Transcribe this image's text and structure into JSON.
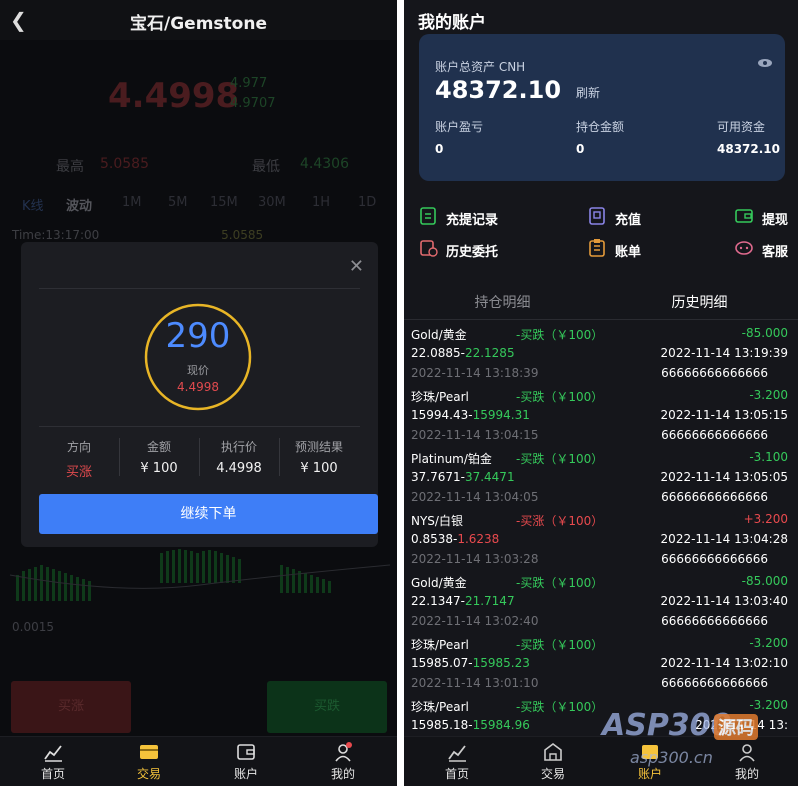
{
  "left": {
    "header": {
      "back_icon": "chevron-left-icon",
      "title": "宝石/Gemstone"
    },
    "ticker": {
      "price": "4.4998",
      "sub1": "4.977",
      "sub2": "4.9707"
    },
    "high_label": "最高",
    "high": "5.0585",
    "low_label": "最低",
    "low": "4.4306",
    "tabs": [
      "K线",
      "波动",
      "1M",
      "5M",
      "15M",
      "30M",
      "1H",
      "1D"
    ],
    "time_line": "Time:13:17:00",
    "time_extra": "5.0585",
    "axis_value": "0.0015",
    "buy_up": "买涨",
    "buy_down": "买跌",
    "modal": {
      "countdown": "290",
      "current_label": "现价",
      "current_value": "4.4998",
      "cols": [
        {
          "h": "方向",
          "v": "买涨"
        },
        {
          "h": "金额",
          "v": "¥ 100"
        },
        {
          "h": "执行价",
          "v": "4.4998"
        },
        {
          "h": "预测结果",
          "v": "¥ 100"
        }
      ],
      "continue": "继续下单"
    },
    "nav": [
      {
        "icon": "chart-icon",
        "label": "首页"
      },
      {
        "icon": "trade-icon",
        "label": "交易"
      },
      {
        "icon": "wallet-icon",
        "label": "账户"
      },
      {
        "icon": "user-icon",
        "label": "我的"
      }
    ]
  },
  "right": {
    "title": "我的账户",
    "card": {
      "assets_label": "账户总资产 CNH",
      "assets": "48372.10",
      "refresh": "刷新",
      "pl_label": "账户盈亏",
      "pl": "0",
      "hold_label": "持仓金额",
      "hold": "0",
      "avail_label": "可用资金",
      "avail": "48372.10"
    },
    "actions": [
      {
        "icon": "withdraw-record-icon",
        "label": "充提记录"
      },
      {
        "icon": "deposit-icon",
        "label": "充值"
      },
      {
        "icon": "withdraw-icon",
        "label": "提现"
      },
      {
        "icon": "history-order-icon",
        "label": "历史委托"
      },
      {
        "icon": "bill-icon",
        "label": "账单"
      },
      {
        "icon": "service-icon",
        "label": "客服"
      }
    ],
    "subtabs": [
      "持仓明细",
      "历史明细"
    ],
    "orders": [
      {
        "name": "Gold/黄金",
        "dir": "-买跌（￥100）",
        "pl": "-85.000",
        "p1": "22.0885-",
        "p2": "22.1285",
        "t2": "2022-11-14 13:19:39",
        "t1": "2022-11-14 13:18:39",
        "id": "66666666666666"
      },
      {
        "name": "珍珠/Pearl",
        "dir": "-买跌（￥100）",
        "pl": "-3.200",
        "p1": "15994.43-",
        "p2": "15994.31",
        "t2": "2022-11-14 13:05:15",
        "t1": "2022-11-14 13:04:15",
        "id": "66666666666666"
      },
      {
        "name": "Platinum/铂金",
        "dir": "-买跌（￥100）",
        "pl": "-3.100",
        "p1": "37.7671-",
        "p2": "37.4471",
        "t2": "2022-11-14 13:05:05",
        "t1": "2022-11-14 13:04:05",
        "id": "66666666666666"
      },
      {
        "name": "NYS/白银",
        "dir": "-买涨（￥100）",
        "pl": "+3.200",
        "p1": "0.8538-",
        "p2": "1.6238",
        "t2": "2022-11-14 13:04:28",
        "t1": "2022-11-14 13:03:28",
        "id": "66666666666666"
      },
      {
        "name": "Gold/黄金",
        "dir": "-买跌（￥100）",
        "pl": "-85.000",
        "p1": "22.1347-",
        "p2": "21.7147",
        "t2": "2022-11-14 13:03:40",
        "t1": "2022-11-14 13:02:40",
        "id": "66666666666666"
      },
      {
        "name": "珍珠/Pearl",
        "dir": "-买跌（￥100）",
        "pl": "-3.200",
        "p1": "15985.07-",
        "p2": "15985.23",
        "t2": "2022-11-14 13:02:10",
        "t1": "2022-11-14 13:01:10",
        "id": "66666666666666"
      },
      {
        "name": "珍珠/Pearl",
        "dir": "-买跌（￥100）",
        "pl": "-3.200",
        "p1": "15985.18-",
        "p2": "15984.96",
        "t2": "2022-11-14 13:",
        "t1": "",
        "id": ""
      }
    ],
    "nav": [
      {
        "icon": "chart-icon",
        "label": "首页"
      },
      {
        "icon": "trade-icon",
        "label": "交易"
      },
      {
        "icon": "wallet-icon",
        "label": "账户"
      },
      {
        "icon": "user-icon",
        "label": "我的"
      }
    ],
    "watermark": {
      "brand": "ASP300",
      "tag": "源码",
      "url": "asp300.cn"
    }
  },
  "colors": {
    "accent_blue": "#3e7ef7",
    "up_red": "#e84a4e",
    "down_green": "#35c95b",
    "active_yellow": "#f5c33b"
  }
}
